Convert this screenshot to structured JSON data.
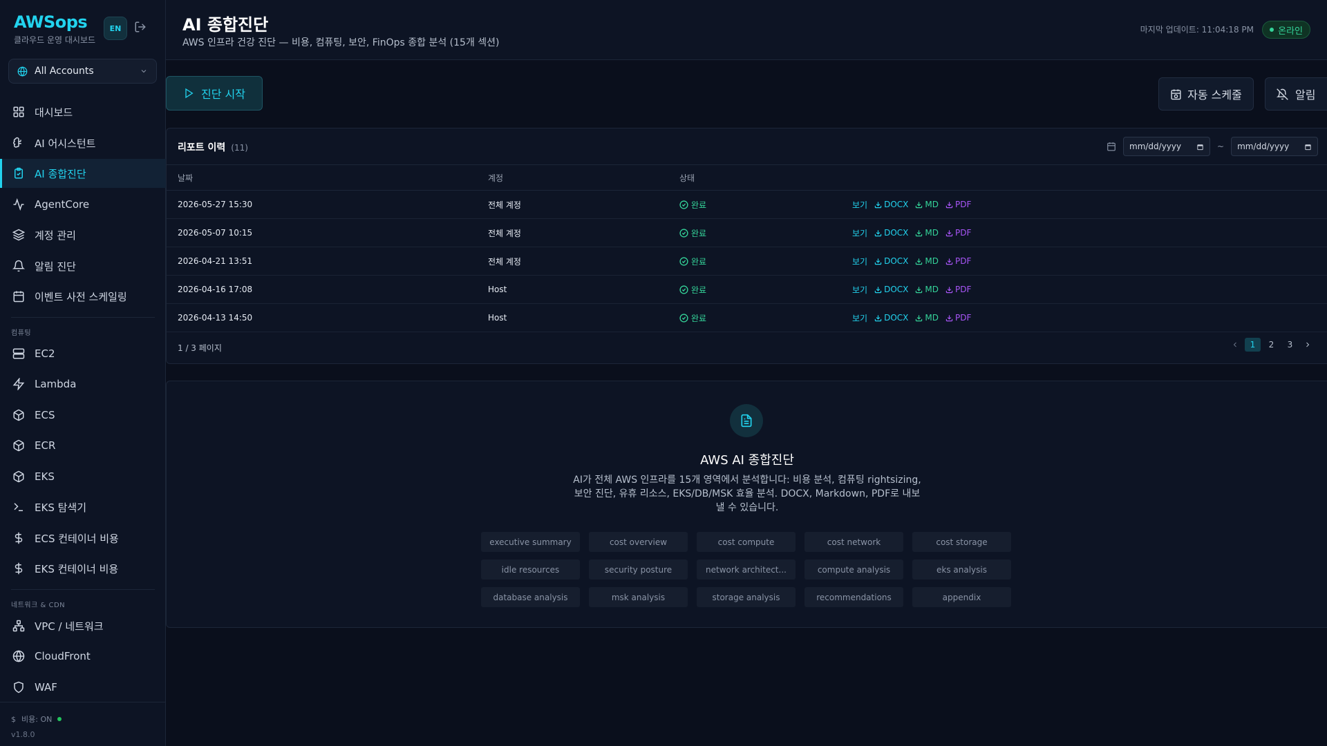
{
  "app": {
    "name": "AWSops",
    "subtitle": "클라우드 운영 대시보드",
    "lang": "EN"
  },
  "account_selector": {
    "value": "All Accounts"
  },
  "nav": {
    "items_main": [
      {
        "label": "대시보드",
        "icon": "grid-icon"
      },
      {
        "label": "AI 어시스턴트",
        "icon": "brain-icon"
      },
      {
        "label": "AI 종합진단",
        "icon": "clipboard-check-icon",
        "active": true
      },
      {
        "label": "AgentCore",
        "icon": "activity-icon"
      },
      {
        "label": "계정 관리",
        "icon": "layers-icon"
      },
      {
        "label": "알림 진단",
        "icon": "bell-icon"
      },
      {
        "label": "이벤트 사전 스케일링",
        "icon": "calendar-icon"
      }
    ],
    "section_compute": "컴퓨팅",
    "items_compute": [
      {
        "label": "EC2",
        "icon": "server-icon"
      },
      {
        "label": "Lambda",
        "icon": "bolt-icon"
      },
      {
        "label": "ECS",
        "icon": "box-icon"
      },
      {
        "label": "ECR",
        "icon": "box-icon"
      },
      {
        "label": "EKS",
        "icon": "box-icon"
      },
      {
        "label": "EKS 탐색기",
        "icon": "terminal-icon"
      },
      {
        "label": "ECS 컨테이너 비용",
        "icon": "dollar-icon"
      },
      {
        "label": "EKS 컨테이너 비용",
        "icon": "dollar-icon"
      }
    ],
    "section_network": "네트워크 & CDN",
    "items_network": [
      {
        "label": "VPC / 네트워크",
        "icon": "network-icon"
      },
      {
        "label": "CloudFront",
        "icon": "globe-icon"
      },
      {
        "label": "WAF",
        "icon": "shield-icon"
      }
    ]
  },
  "footer": {
    "cost_symbol": "$",
    "cost_label": "비용: ON",
    "version": "v1.8.0"
  },
  "header": {
    "title": "AI 종합진단",
    "subtitle": "AWS 인프라 건강 진단 — 비용, 컴퓨팅, 보안, FinOps 종합 분석 (15개 섹션)",
    "last_update": "마지막 업데이트: 11:04:18 PM",
    "status": "온라인"
  },
  "toolbar": {
    "start_label": "진단 시작",
    "schedule_label": "자동 스케줄",
    "alert_label": "알림"
  },
  "reports": {
    "title": "리포트 이력",
    "count": "(11)",
    "date_from_placeholder": "mm/dd/yyyy",
    "date_to_placeholder": "mm/dd/yyyy",
    "date_sep": "~",
    "columns": [
      "날짜",
      "계정",
      "상태"
    ],
    "rows": [
      {
        "date": "2026-05-27 15:30",
        "account": "전체 계정",
        "status": "완료"
      },
      {
        "date": "2026-05-07 10:15",
        "account": "전체 계정",
        "status": "완료"
      },
      {
        "date": "2026-04-21 13:51",
        "account": "전체 계정",
        "status": "완료"
      },
      {
        "date": "2026-04-16 17:08",
        "account": "Host",
        "status": "완료"
      },
      {
        "date": "2026-04-13 14:50",
        "account": "Host",
        "status": "완료"
      }
    ],
    "actions": {
      "view": "보기",
      "docx": "DOCX",
      "md": "MD",
      "pdf": "PDF"
    },
    "pager_info": "1 / 3 페이지",
    "pages": [
      "1",
      "2",
      "3"
    ],
    "current_page": "1"
  },
  "intro": {
    "title": "AWS AI 종합진단",
    "description": "AI가 전체 AWS 인프라를 15개 영역에서 분석합니다: 비용 분석, 컴퓨팅 rightsizing, 보안 진단, 유휴 리소스, EKS/DB/MSK 효율 분석. DOCX, Markdown, PDF로 내보낼 수 있습니다.",
    "sections": [
      "executive summary",
      "cost overview",
      "cost compute",
      "cost network",
      "cost storage",
      "idle resources",
      "security posture",
      "network architect...",
      "compute analysis",
      "eks analysis",
      "database analysis",
      "msk analysis",
      "storage analysis",
      "recommendations",
      "appendix"
    ]
  },
  "colors": {
    "accent": "#22d3ee",
    "success": "#34d399",
    "pdf": "#a855f7",
    "background": "#0a0f1c",
    "panel": "#0d1424"
  }
}
